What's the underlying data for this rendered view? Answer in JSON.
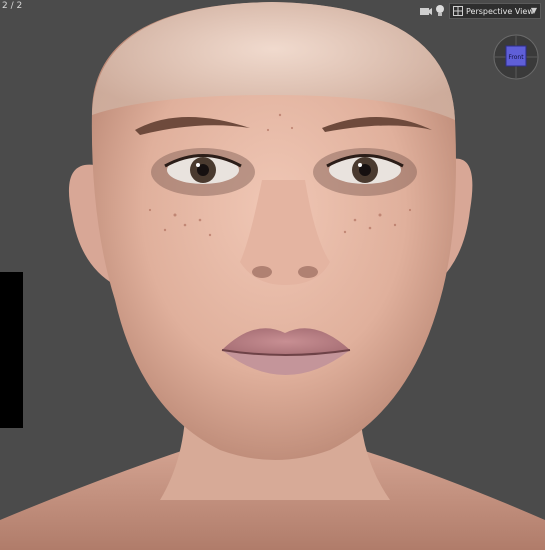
{
  "viewport": {
    "frame_counter": "2 / 2",
    "camera": {
      "selected": "Perspective View",
      "dropdown_icon": "chevron-down-icon"
    },
    "toolbar_icons": [
      "camera-icon",
      "light-icon",
      "view-layout-icon"
    ],
    "nav_cube": {
      "face_label": "Front"
    },
    "colors": {
      "viewport_bg": "#4b4b4b",
      "skin": "#e3b8a5",
      "nav_cube_face": "#5f5fd8"
    }
  }
}
